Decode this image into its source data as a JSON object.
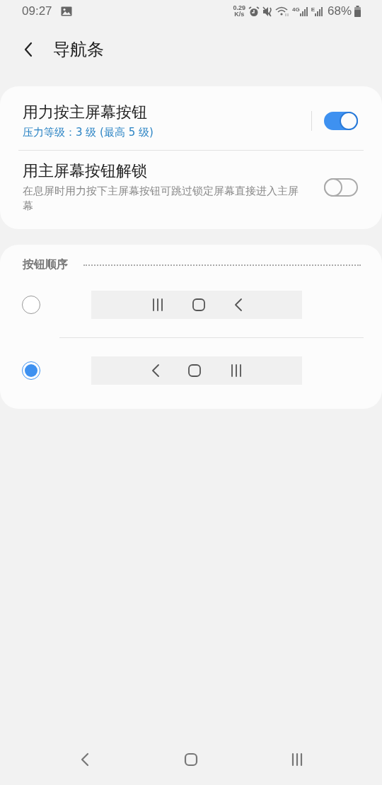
{
  "status_bar": {
    "time": "09:27",
    "net_speed": [
      "0.29",
      "K/s"
    ],
    "network": [
      "4G",
      "E"
    ],
    "battery": "68%"
  },
  "header": {
    "title": "导航条"
  },
  "settings": [
    {
      "title": "用力按主屏幕按钮",
      "subtitle": "压力等级：3 级 (最高 5 级)",
      "accent": true,
      "separator": true,
      "on": true
    },
    {
      "title": "用主屏幕按钮解锁",
      "subtitle": "在息屏时用力按下主屏幕按钮可跳过锁定屏幕直接进入主屏幕",
      "accent": false,
      "separator": false,
      "on": false
    }
  ],
  "button_order": {
    "heading": "按钮顺序",
    "options": [
      {
        "selected": false,
        "buttons": [
          {
            "kind": "recents"
          },
          {
            "kind": "home"
          },
          {
            "kind": "back"
          }
        ]
      },
      {
        "selected": true,
        "buttons": [
          {
            "kind": "back"
          },
          {
            "kind": "home"
          },
          {
            "kind": "recents"
          }
        ]
      }
    ]
  },
  "nav_bar": {
    "buttons": [
      {
        "kind": "back"
      },
      {
        "kind": "home"
      },
      {
        "kind": "recents"
      }
    ]
  }
}
